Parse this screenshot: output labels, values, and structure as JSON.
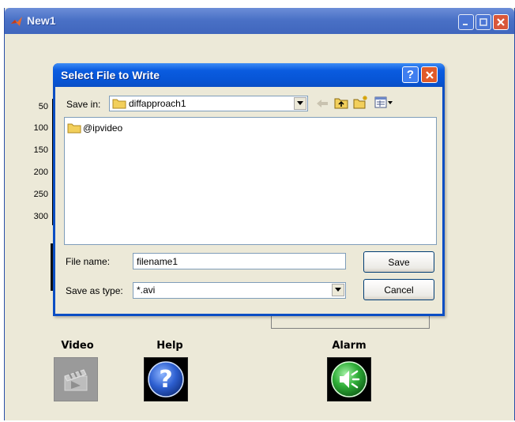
{
  "main_window": {
    "title": "New1"
  },
  "axes": {
    "y_ticks": [
      "50",
      "100",
      "150",
      "200",
      "250",
      "300"
    ]
  },
  "controls": {
    "video_label": "Video",
    "help_label": "Help",
    "alarm_label": "Alarm",
    "help_glyph": "?"
  },
  "dialog": {
    "title": "Select File to Write",
    "help_glyph": "?",
    "save_in_label": "Save in:",
    "save_in_value": "diffapproach1",
    "items": [
      {
        "name": "@ipvideo",
        "icon": "folder-icon"
      }
    ],
    "file_name_label": "File name:",
    "file_name_value": "filename1",
    "save_as_type_label": "Save as type:",
    "save_as_type_value": "*.avi",
    "save_button": "Save",
    "cancel_button": "Cancel"
  },
  "colors": {
    "xp_titlebar": "#0755d6",
    "help_button": "#1f4fa8",
    "alarm_button": "#3dbb44"
  }
}
